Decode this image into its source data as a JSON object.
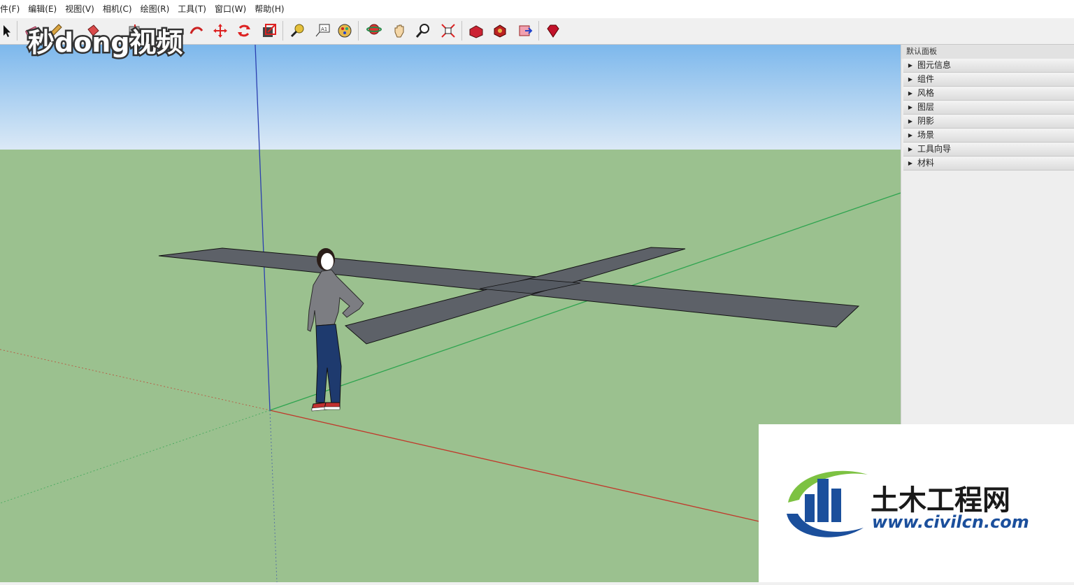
{
  "menubar": {
    "items": [
      "件(F)",
      "编辑(E)",
      "视图(V)",
      "相机(C)",
      "绘图(R)",
      "工具(T)",
      "窗口(W)",
      "帮助(H)"
    ]
  },
  "toolbar": {
    "tools": [
      "select-arrow-icon",
      "eraser-icon",
      "pencil-icon",
      "paint-bucket-icon",
      "push-pull-icon",
      "follow-me-icon",
      "move-icon",
      "rotate-icon",
      "scale-icon",
      "tape-measure-icon",
      "text-label-icon",
      "paint-icon",
      "orbit-icon",
      "pan-hand-icon",
      "zoom-icon",
      "zoom-extents-icon",
      "3d-warehouse-icon",
      "components-icon",
      "extension-warehouse-icon",
      "ruby-icon"
    ],
    "text_tool_glyph": "A1"
  },
  "watermark_logo": {
    "text": "秒dong视频"
  },
  "panel": {
    "title": "默认面板",
    "trays": [
      "图元信息",
      "组件",
      "风格",
      "图层",
      "阴影",
      "场景",
      "工具向导",
      "材料"
    ]
  },
  "site_watermark": {
    "name": "土木工程网",
    "url": "www.civilcn.com"
  },
  "colors": {
    "sky_top": "#7db8ec",
    "sky_bottom": "#dbe9f6",
    "ground": "#9bc18f",
    "face": "#5d6168",
    "red_axis": "#c0392b",
    "green_axis": "#2ea44f",
    "blue_axis": "#2b3fb0",
    "logo_blue": "#1b4f9c",
    "logo_green": "#7dc242"
  }
}
